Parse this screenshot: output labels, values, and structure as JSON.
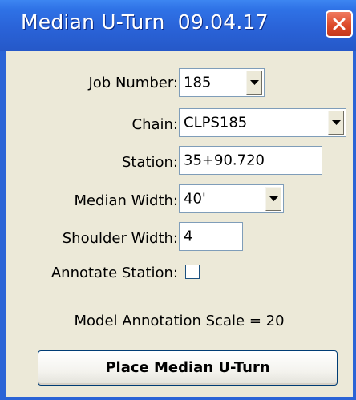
{
  "window": {
    "title": "Median U-Turn  09.04.17",
    "title_color": "#2a63d8",
    "close_color": "#dd4b2a"
  },
  "form": {
    "job_number": {
      "label": "Job Number:",
      "value": "185"
    },
    "chain": {
      "label": "Chain:",
      "value": "CLPS185"
    },
    "station": {
      "label": "Station:",
      "value": "35+90.720"
    },
    "median_width": {
      "label": "Median Width:",
      "value": "40'"
    },
    "shoulder_width": {
      "label": "Shoulder Width:",
      "value": "4"
    },
    "annotate_station": {
      "label": "Annotate Station:",
      "checked": false
    }
  },
  "info": {
    "scale_text": "Model Annotation Scale = 20"
  },
  "actions": {
    "place_label": "Place Median U-Turn"
  }
}
